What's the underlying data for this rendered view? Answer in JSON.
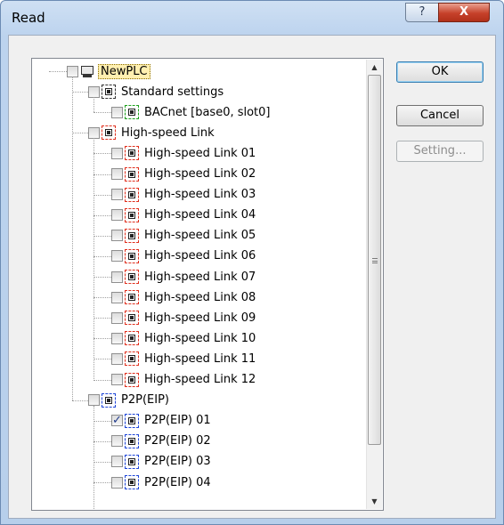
{
  "window": {
    "title": "Read"
  },
  "titlebar_buttons": {
    "help": "?",
    "close": "X"
  },
  "buttons": {
    "ok": "OK",
    "cancel": "Cancel",
    "setting": "Setting..."
  },
  "tree": [
    {
      "label": "NewPLC",
      "level": 0,
      "icon": "plc-icon",
      "checked": false,
      "selected": true
    },
    {
      "label": "Standard settings",
      "level": 1,
      "icon": "standard-settings-icon",
      "color": "#333333",
      "checked": false
    },
    {
      "label": "BACnet [base0, slot0]",
      "level": 2,
      "icon": "bacnet-icon",
      "color": "#1ea01e",
      "checked": false
    },
    {
      "label": "High-speed Link",
      "level": 1,
      "icon": "high-speed-link-icon",
      "color": "#e0301e",
      "checked": false
    },
    {
      "label": "High-speed Link 01",
      "level": 2,
      "icon": "high-speed-link-icon",
      "color": "#e0301e",
      "checked": false
    },
    {
      "label": "High-speed Link 02",
      "level": 2,
      "icon": "high-speed-link-icon",
      "color": "#e0301e",
      "checked": false
    },
    {
      "label": "High-speed Link 03",
      "level": 2,
      "icon": "high-speed-link-icon",
      "color": "#e0301e",
      "checked": false
    },
    {
      "label": "High-speed Link 04",
      "level": 2,
      "icon": "high-speed-link-icon",
      "color": "#e0301e",
      "checked": false
    },
    {
      "label": "High-speed Link 05",
      "level": 2,
      "icon": "high-speed-link-icon",
      "color": "#e0301e",
      "checked": false
    },
    {
      "label": "High-speed Link 06",
      "level": 2,
      "icon": "high-speed-link-icon",
      "color": "#e0301e",
      "checked": false
    },
    {
      "label": "High-speed Link 07",
      "level": 2,
      "icon": "high-speed-link-icon",
      "color": "#e0301e",
      "checked": false
    },
    {
      "label": "High-speed Link 08",
      "level": 2,
      "icon": "high-speed-link-icon",
      "color": "#e0301e",
      "checked": false
    },
    {
      "label": "High-speed Link 09",
      "level": 2,
      "icon": "high-speed-link-icon",
      "color": "#e0301e",
      "checked": false
    },
    {
      "label": "High-speed Link 10",
      "level": 2,
      "icon": "high-speed-link-icon",
      "color": "#e0301e",
      "checked": false
    },
    {
      "label": "High-speed Link 11",
      "level": 2,
      "icon": "high-speed-link-icon",
      "color": "#e0301e",
      "checked": false
    },
    {
      "label": "High-speed Link 12",
      "level": 2,
      "icon": "high-speed-link-icon",
      "color": "#e0301e",
      "checked": false
    },
    {
      "label": "P2P(EIP)",
      "level": 1,
      "icon": "p2p-eip-icon",
      "color": "#1e46d8",
      "checked": false
    },
    {
      "label": "P2P(EIP) 01",
      "level": 2,
      "icon": "p2p-eip-icon",
      "color": "#1e46d8",
      "checked": true
    },
    {
      "label": "P2P(EIP) 02",
      "level": 2,
      "icon": "p2p-eip-icon",
      "color": "#1e46d8",
      "checked": false
    },
    {
      "label": "P2P(EIP) 03",
      "level": 2,
      "icon": "p2p-eip-icon",
      "color": "#1e46d8",
      "checked": false
    },
    {
      "label": "P2P(EIP) 04",
      "level": 2,
      "icon": "p2p-eip-icon",
      "color": "#1e46d8",
      "checked": false
    }
  ],
  "scrollbar": {
    "up": "▲",
    "down": "▼"
  },
  "colors": {
    "selection_highlight": "#ffefb0",
    "default_button_border": "#3c7fb1"
  }
}
